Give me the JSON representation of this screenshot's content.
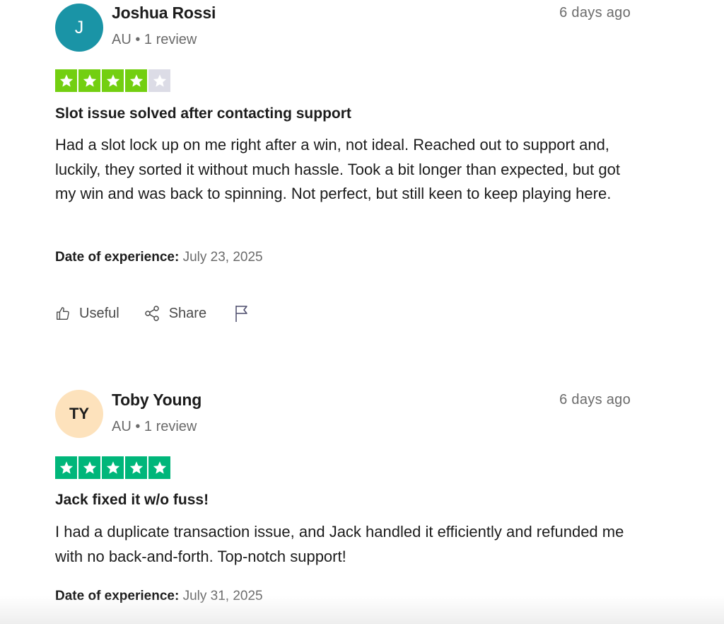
{
  "reviews": [
    {
      "avatar_text": "J",
      "avatar_bg": "#1a94a6",
      "avatar_fg": "#ffffff",
      "name": "Joshua Rossi",
      "meta": "AU • 1 review",
      "time_ago": "6 days ago",
      "rating": 4,
      "star_color": "#73cf11",
      "title": "Slot issue solved after contacting support",
      "body": "Had a slot lock up on me right after a win, not ideal. Reached out to support and, luckily, they sorted it without much hassle. Took a bit longer than expected, but got my win and was back to spinning. Not perfect, but still keen to keep playing here.",
      "date_label": "Date of experience:",
      "date_value": "July 23, 2025",
      "actions": {
        "useful": "Useful",
        "share": "Share"
      }
    },
    {
      "avatar_text": "TY",
      "avatar_bg": "#fde2bc",
      "avatar_fg": "#1c1c1c",
      "name": "Toby Young",
      "meta": "AU • 1 review",
      "time_ago": "6 days ago",
      "rating": 5,
      "star_color": "#00b67a",
      "title": "Jack fixed it w/o fuss!",
      "body": "I had a duplicate transaction issue, and Jack handled it efficiently and refunded me with no back-and-forth. Top-notch support!",
      "date_label": "Date of experience:",
      "date_value": "July 31, 2025"
    }
  ],
  "icons": {
    "star": "star-icon",
    "thumbs_up": "thumbs-up-icon",
    "share": "share-icon",
    "flag": "flag-icon"
  },
  "colors": {
    "empty_star_bg": "#dcdce6",
    "text_primary": "#1c1c1c",
    "text_secondary": "#6b6b6b"
  }
}
